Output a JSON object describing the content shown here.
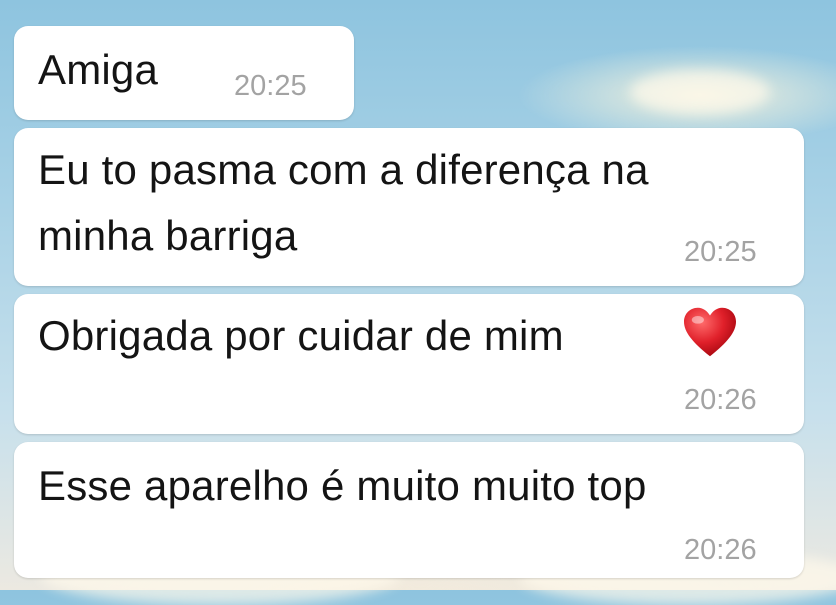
{
  "messages": [
    {
      "text": "Amiga",
      "time": "20:25"
    },
    {
      "line1": "Eu to pasma com a diferença na",
      "line2": "minha barriga",
      "time": "20:25"
    },
    {
      "text": "Obrigada por cuidar de mim",
      "emoji": "heart-icon",
      "time": "20:26"
    },
    {
      "text": "Esse aparelho é muito muito top",
      "time": "20:26"
    }
  ],
  "colors": {
    "bubble": "#ffffff",
    "text": "#141414",
    "time": "#a3a3a3",
    "heart": "#d81b23"
  }
}
